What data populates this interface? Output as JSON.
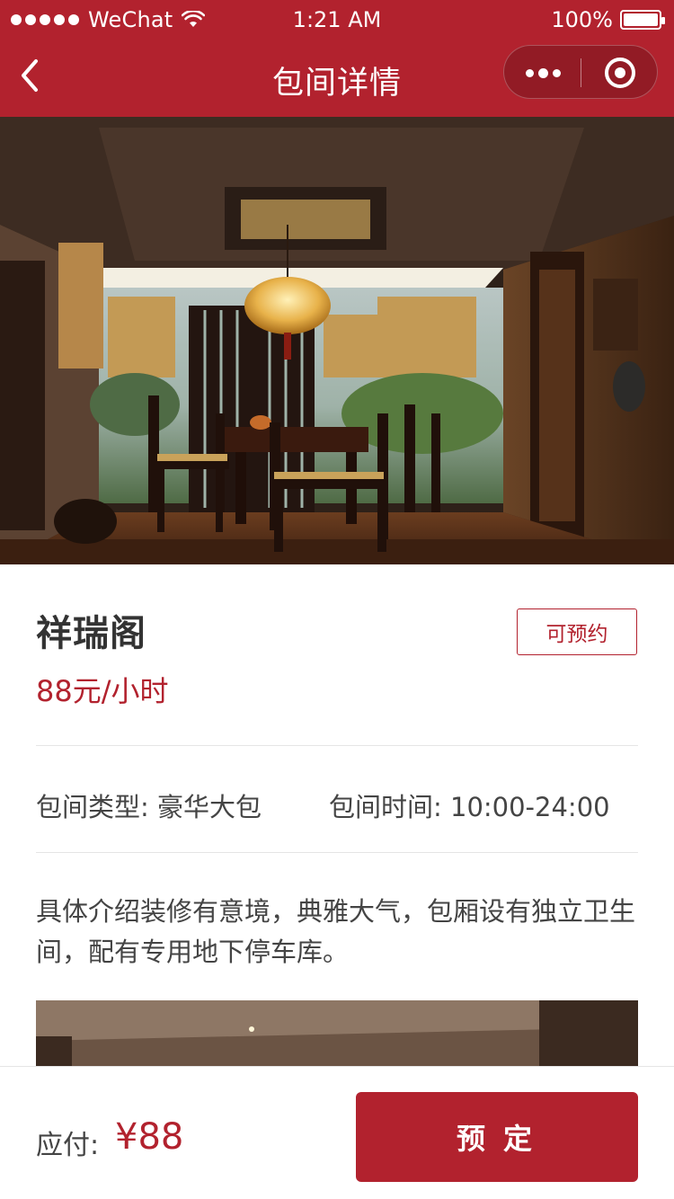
{
  "status_bar": {
    "carrier": "WeChat",
    "time": "1:21 AM",
    "battery": "100%"
  },
  "nav": {
    "title": "包间详情"
  },
  "room": {
    "name": "祥瑞阁",
    "status": "可预约",
    "price": "88元/小时",
    "type_label": "包间类型: 豪华大包",
    "time_label": "包间时间: 10:00-24:00",
    "description": "具体介绍装修有意境，典雅大气，包厢设有独立卫生间，配有专用地下停车库。"
  },
  "bottom": {
    "pay_label": "应付:",
    "pay_amount": "¥88",
    "book_label": "预定"
  },
  "colors": {
    "brand": "#b2222e"
  }
}
